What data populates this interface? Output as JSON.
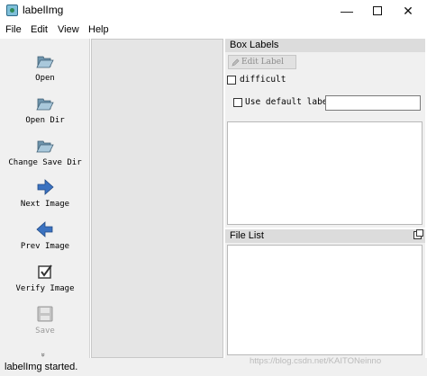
{
  "window": {
    "title": "labelImg",
    "min_glyph": "—",
    "close_glyph": "✕"
  },
  "menu": [
    "File",
    "Edit",
    "View",
    "Help"
  ],
  "toolbar": {
    "tools": [
      {
        "label": "Open",
        "icon": "folder-open-icon",
        "enabled": true
      },
      {
        "label": "Open Dir",
        "icon": "folder-open-icon",
        "enabled": true
      },
      {
        "label": "Change Save Dir",
        "icon": "folder-open-icon",
        "enabled": true
      },
      {
        "label": "Next Image",
        "icon": "arrow-right-icon",
        "enabled": true
      },
      {
        "label": "Prev Image",
        "icon": "arrow-left-icon",
        "enabled": true
      },
      {
        "label": "Verify Image",
        "icon": "checkbox-checked-icon",
        "enabled": true
      },
      {
        "label": "Save",
        "icon": "floppy-disk-icon",
        "enabled": false
      }
    ],
    "more_glyph": "»"
  },
  "box_labels": {
    "title": "Box Labels",
    "edit_label": "Edit Label",
    "difficult_label": "difficult",
    "difficult_checked": false,
    "use_default_label": "Use default label",
    "use_default_checked": false,
    "default_label_value": ""
  },
  "file_list": {
    "title": "File List"
  },
  "status": {
    "text": "labelImg started."
  },
  "watermark": "https://blog.csdn.net/KAITONeinno",
  "colors": {
    "folder": "#8fb3c9",
    "arrow": "#3b72c0",
    "window_bg": "#f0f0f0",
    "canvas_bg": "#e5e5e5"
  }
}
